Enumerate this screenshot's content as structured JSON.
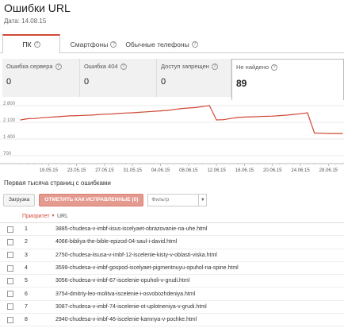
{
  "header": {
    "title": "Ошибки URL",
    "date_label": "Дата: 14.08.15"
  },
  "tabs": [
    {
      "label": "ПК",
      "active": true
    },
    {
      "label": "Смартфоны",
      "active": false
    },
    {
      "label": "Обычные телефоны",
      "active": false
    }
  ],
  "cards": [
    {
      "label": "Ошибка сервера",
      "value": "0",
      "selected": false
    },
    {
      "label": "Ошибка 404",
      "value": "0",
      "selected": false
    },
    {
      "label": "Доступ запрещен",
      "value": "0",
      "selected": false
    },
    {
      "label": "Не найдено",
      "value": "89",
      "selected": true
    }
  ],
  "chart_data": {
    "type": "line",
    "x": [
      "15.05.15",
      "16.05.15",
      "17.05.15",
      "18.05.15",
      "19.05.15",
      "20.05.15",
      "21.05.15",
      "22.05.15",
      "23.05.15",
      "24.05.15",
      "25.05.15",
      "26.05.15",
      "27.05.15",
      "28.05.15",
      "29.05.15",
      "30.05.15",
      "31.05.15",
      "01.06.15",
      "02.06.15",
      "03.06.15",
      "04.06.15",
      "05.06.15",
      "06.06.15",
      "07.06.15",
      "08.06.15",
      "09.06.15",
      "10.06.15",
      "11.06.15",
      "12.06.15",
      "13.06.15",
      "14.06.15",
      "15.06.15",
      "16.06.15",
      "17.06.15",
      "18.06.15",
      "19.06.15",
      "20.06.15",
      "21.06.15",
      "22.06.15",
      "23.06.15",
      "24.06.15",
      "25.06.15",
      "26.06.15",
      "27.06.15",
      "28.06.15",
      "29.06.15",
      "30.06.15"
    ],
    "series": [
      {
        "values": [
          2200,
          2250,
          2260,
          2290,
          2310,
          2330,
          2350,
          2370,
          2380,
          2390,
          2400,
          2420,
          2440,
          2450,
          2470,
          2490,
          2500,
          2520,
          2540,
          2560,
          2580,
          2600,
          2640,
          2680,
          2700,
          2720,
          2760,
          2800,
          2200,
          2210,
          2260,
          2300,
          2320,
          2330,
          2340,
          2350,
          2360,
          2380,
          2400,
          2430,
          2460,
          2500,
          1650,
          1640,
          1630,
          1630,
          1630
        ]
      }
    ],
    "y_ticks": [
      "2 800",
      "2 100",
      "1 400",
      "700"
    ],
    "y_tick_values": [
      2800,
      2100,
      1400,
      700
    ],
    "ylim": [
      500,
      2900
    ],
    "x_ticks": [
      "19.05.15",
      "23.05.15",
      "27.05.15",
      "31.05.15",
      "04.06.15",
      "08.06.15",
      "12.06.15",
      "16.06.15",
      "20.06.15",
      "24.06.15",
      "28.06.15"
    ],
    "color": "#d14836",
    "grid": true
  },
  "list": {
    "title": "Первая тысяча страниц с ошибками",
    "download_label": "Загрузка",
    "fix_label": "ОТМЕТИТЬ КАК ИСПРАВЛЕННЫЕ (0)",
    "filter_placeholder": "Фильтр",
    "col_priority": "Приоритет",
    "col_url": "URL",
    "rows": [
      {
        "priority": "1",
        "url": "3885-chudesa-v-imbf-iisus-iscelyaet-obrazovanie-na-uhe.html"
      },
      {
        "priority": "2",
        "url": "4066-bibliya-the-bible-epizod-04-saul-i-david.html"
      },
      {
        "priority": "3",
        "url": "2750-chudesa-iisusa-v-imbf-12-iscelenie-kisty-v-oblasti-viska.html"
      },
      {
        "priority": "4",
        "url": "3599-chudesa-v-imbf-gospod-iscelyaet-pigmentnuyu-opuhol-na-spine.html"
      },
      {
        "priority": "5",
        "url": "3056-chudesa-v-imbf-67-iscelenie-opuholi-v-grudi.html"
      },
      {
        "priority": "6",
        "url": "3754-dmitriy-leo-molitva-iscelenie-i-osvobozhdeniya.html"
      },
      {
        "priority": "7",
        "url": "3087-chudesa-v-imbf-74-iscelenie-ot-uplotneniya-v-grudi.html"
      },
      {
        "priority": "8",
        "url": "2940-chudesa-v-imbf-46-iscelenie-kamnya-v-pochke.html"
      }
    ]
  }
}
